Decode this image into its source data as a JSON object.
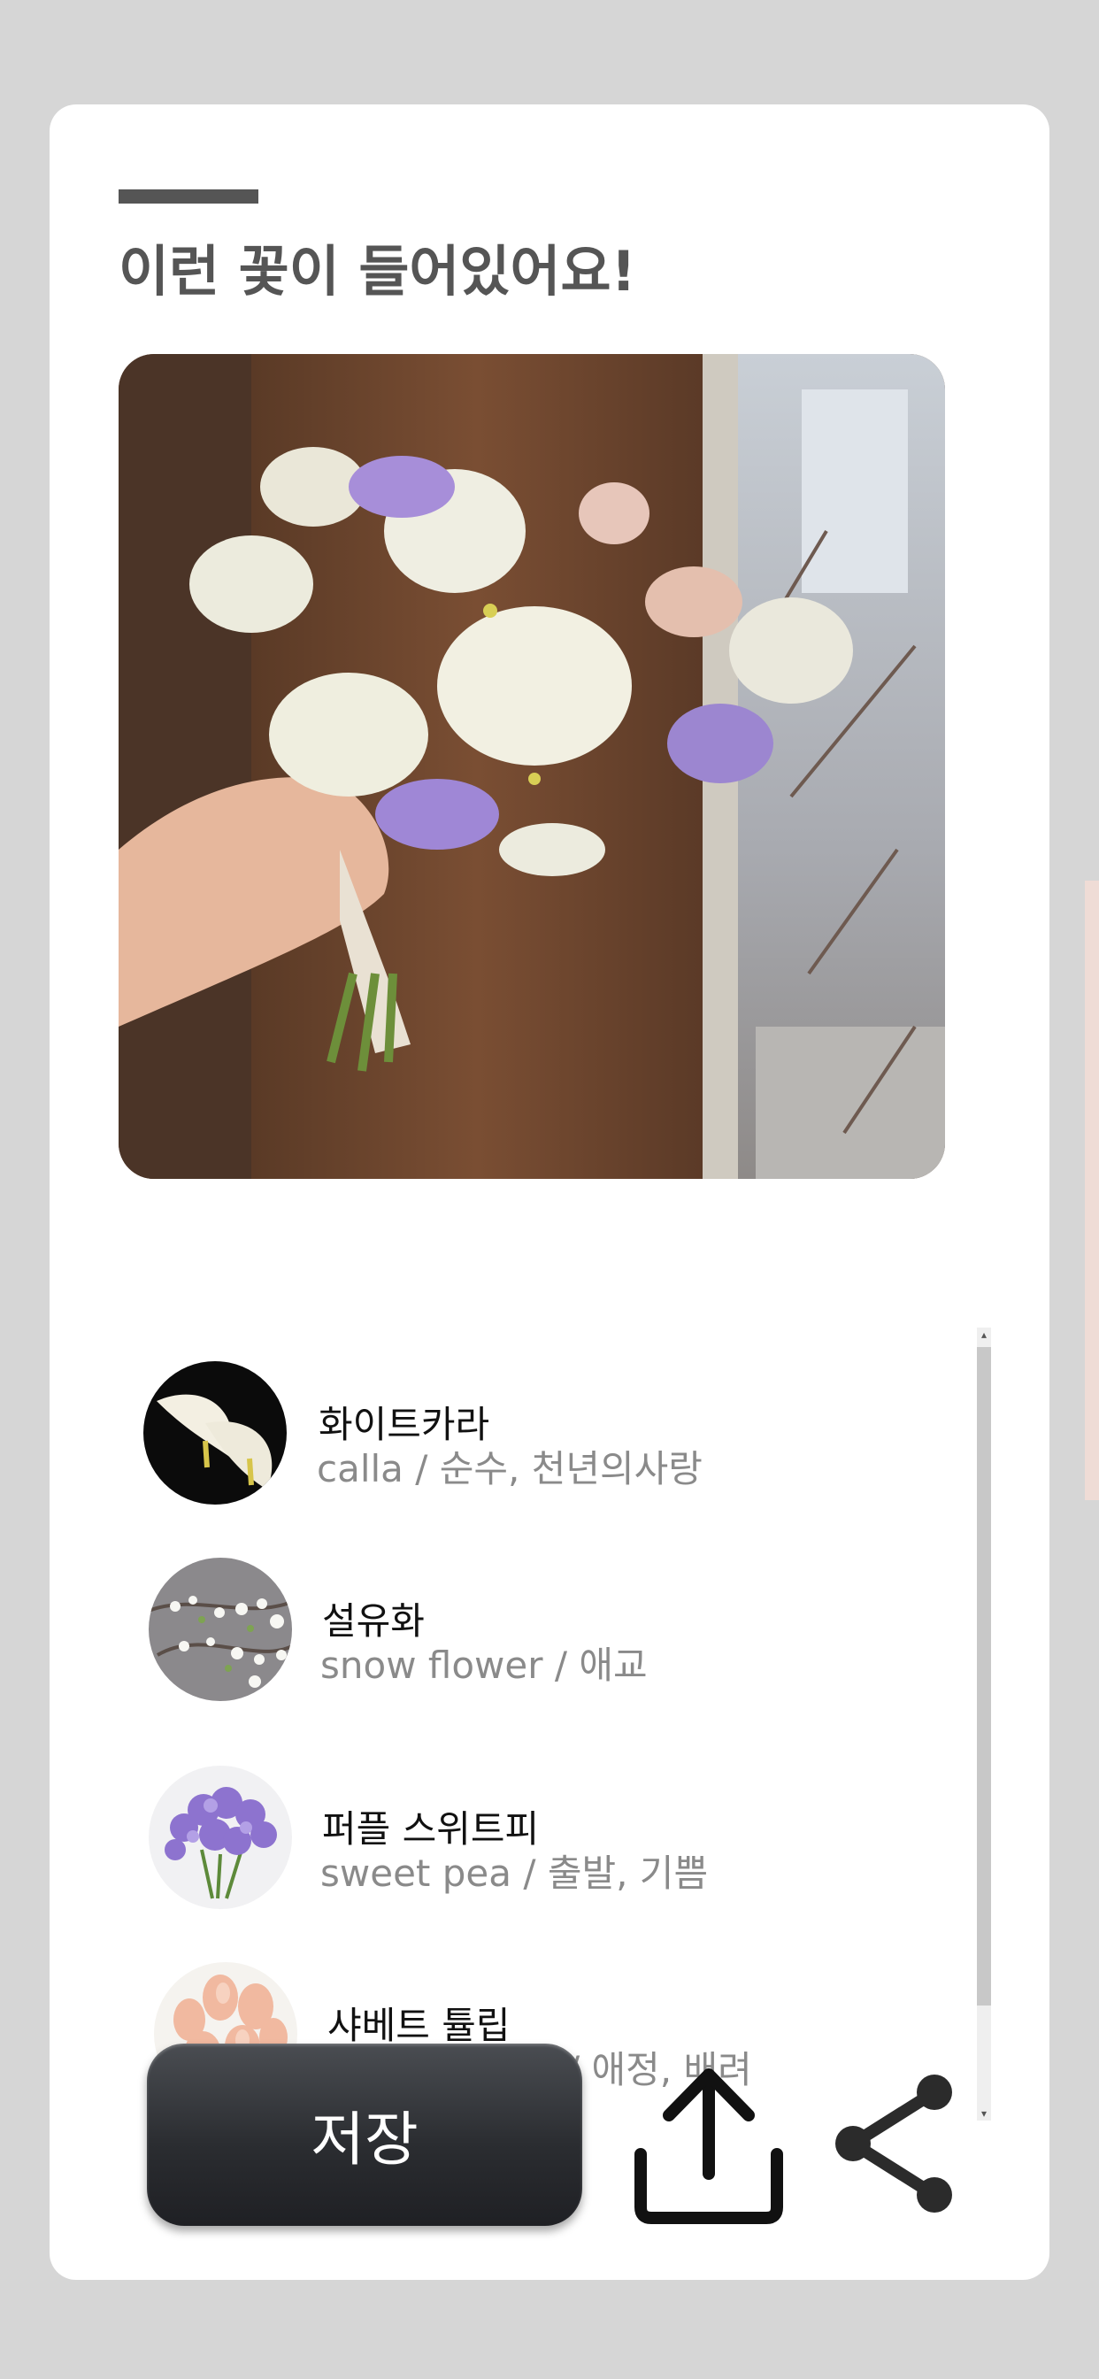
{
  "header": {
    "title": "이런 꽃이 들어있어요!"
  },
  "flowers": [
    {
      "name": "화이트카라",
      "desc": "calla / 순수, 천년의사랑",
      "thumb": "white-calla"
    },
    {
      "name": "설유화",
      "desc": "snow flower / 애교",
      "thumb": "snow-flower"
    },
    {
      "name": "퍼플 스위트피",
      "desc": "sweet pea / 출발, 기쁨",
      "thumb": "purple-sweet-pea"
    },
    {
      "name": "샤베트 튤립",
      "desc": "tulip sherbet/ 애정, 배려",
      "thumb": "tulip-sherbet"
    }
  ],
  "actions": {
    "save_label": "저장",
    "export_icon": "upload-icon",
    "share_icon": "share-icon"
  },
  "colors": {
    "background": "#d6d6d6",
    "card": "#ffffff",
    "title": "#555555",
    "button": "#2b2d31"
  }
}
